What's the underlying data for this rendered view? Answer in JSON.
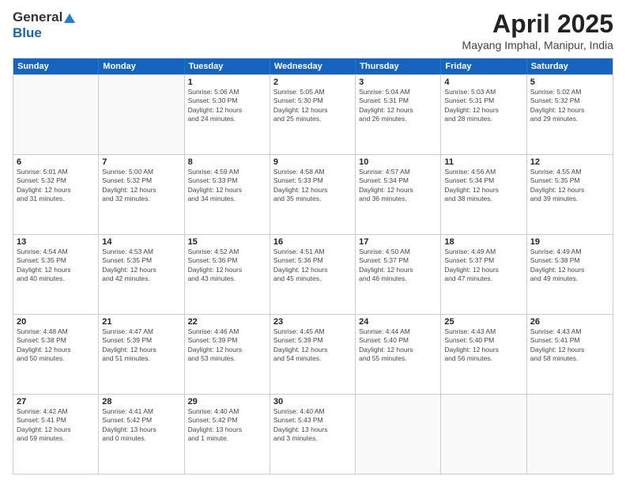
{
  "header": {
    "logo_general": "General",
    "logo_blue": "Blue",
    "month_title": "April 2025",
    "subtitle": "Mayang Imphal, Manipur, India"
  },
  "calendar": {
    "days_of_week": [
      "Sunday",
      "Monday",
      "Tuesday",
      "Wednesday",
      "Thursday",
      "Friday",
      "Saturday"
    ],
    "weeks": [
      [
        {
          "day": "",
          "info": ""
        },
        {
          "day": "",
          "info": ""
        },
        {
          "day": "1",
          "info": "Sunrise: 5:06 AM\nSunset: 5:30 PM\nDaylight: 12 hours\nand 24 minutes."
        },
        {
          "day": "2",
          "info": "Sunrise: 5:05 AM\nSunset: 5:30 PM\nDaylight: 12 hours\nand 25 minutes."
        },
        {
          "day": "3",
          "info": "Sunrise: 5:04 AM\nSunset: 5:31 PM\nDaylight: 12 hours\nand 26 minutes."
        },
        {
          "day": "4",
          "info": "Sunrise: 5:03 AM\nSunset: 5:31 PM\nDaylight: 12 hours\nand 28 minutes."
        },
        {
          "day": "5",
          "info": "Sunrise: 5:02 AM\nSunset: 5:32 PM\nDaylight: 12 hours\nand 29 minutes."
        }
      ],
      [
        {
          "day": "6",
          "info": "Sunrise: 5:01 AM\nSunset: 5:32 PM\nDaylight: 12 hours\nand 31 minutes."
        },
        {
          "day": "7",
          "info": "Sunrise: 5:00 AM\nSunset: 5:32 PM\nDaylight: 12 hours\nand 32 minutes."
        },
        {
          "day": "8",
          "info": "Sunrise: 4:59 AM\nSunset: 5:33 PM\nDaylight: 12 hours\nand 34 minutes."
        },
        {
          "day": "9",
          "info": "Sunrise: 4:58 AM\nSunset: 5:33 PM\nDaylight: 12 hours\nand 35 minutes."
        },
        {
          "day": "10",
          "info": "Sunrise: 4:57 AM\nSunset: 5:34 PM\nDaylight: 12 hours\nand 36 minutes."
        },
        {
          "day": "11",
          "info": "Sunrise: 4:56 AM\nSunset: 5:34 PM\nDaylight: 12 hours\nand 38 minutes."
        },
        {
          "day": "12",
          "info": "Sunrise: 4:55 AM\nSunset: 5:35 PM\nDaylight: 12 hours\nand 39 minutes."
        }
      ],
      [
        {
          "day": "13",
          "info": "Sunrise: 4:54 AM\nSunset: 5:35 PM\nDaylight: 12 hours\nand 40 minutes."
        },
        {
          "day": "14",
          "info": "Sunrise: 4:53 AM\nSunset: 5:35 PM\nDaylight: 12 hours\nand 42 minutes."
        },
        {
          "day": "15",
          "info": "Sunrise: 4:52 AM\nSunset: 5:36 PM\nDaylight: 12 hours\nand 43 minutes."
        },
        {
          "day": "16",
          "info": "Sunrise: 4:51 AM\nSunset: 5:36 PM\nDaylight: 12 hours\nand 45 minutes."
        },
        {
          "day": "17",
          "info": "Sunrise: 4:50 AM\nSunset: 5:37 PM\nDaylight: 12 hours\nand 46 minutes."
        },
        {
          "day": "18",
          "info": "Sunrise: 4:49 AM\nSunset: 5:37 PM\nDaylight: 12 hours\nand 47 minutes."
        },
        {
          "day": "19",
          "info": "Sunrise: 4:49 AM\nSunset: 5:38 PM\nDaylight: 12 hours\nand 49 minutes."
        }
      ],
      [
        {
          "day": "20",
          "info": "Sunrise: 4:48 AM\nSunset: 5:38 PM\nDaylight: 12 hours\nand 50 minutes."
        },
        {
          "day": "21",
          "info": "Sunrise: 4:47 AM\nSunset: 5:39 PM\nDaylight: 12 hours\nand 51 minutes."
        },
        {
          "day": "22",
          "info": "Sunrise: 4:46 AM\nSunset: 5:39 PM\nDaylight: 12 hours\nand 53 minutes."
        },
        {
          "day": "23",
          "info": "Sunrise: 4:45 AM\nSunset: 5:39 PM\nDaylight: 12 hours\nand 54 minutes."
        },
        {
          "day": "24",
          "info": "Sunrise: 4:44 AM\nSunset: 5:40 PM\nDaylight: 12 hours\nand 55 minutes."
        },
        {
          "day": "25",
          "info": "Sunrise: 4:43 AM\nSunset: 5:40 PM\nDaylight: 12 hours\nand 56 minutes."
        },
        {
          "day": "26",
          "info": "Sunrise: 4:43 AM\nSunset: 5:41 PM\nDaylight: 12 hours\nand 58 minutes."
        }
      ],
      [
        {
          "day": "27",
          "info": "Sunrise: 4:42 AM\nSunset: 5:41 PM\nDaylight: 12 hours\nand 59 minutes."
        },
        {
          "day": "28",
          "info": "Sunrise: 4:41 AM\nSunset: 5:42 PM\nDaylight: 13 hours\nand 0 minutes."
        },
        {
          "day": "29",
          "info": "Sunrise: 4:40 AM\nSunset: 5:42 PM\nDaylight: 13 hours\nand 1 minute."
        },
        {
          "day": "30",
          "info": "Sunrise: 4:40 AM\nSunset: 5:43 PM\nDaylight: 13 hours\nand 3 minutes."
        },
        {
          "day": "",
          "info": ""
        },
        {
          "day": "",
          "info": ""
        },
        {
          "day": "",
          "info": ""
        }
      ]
    ]
  }
}
